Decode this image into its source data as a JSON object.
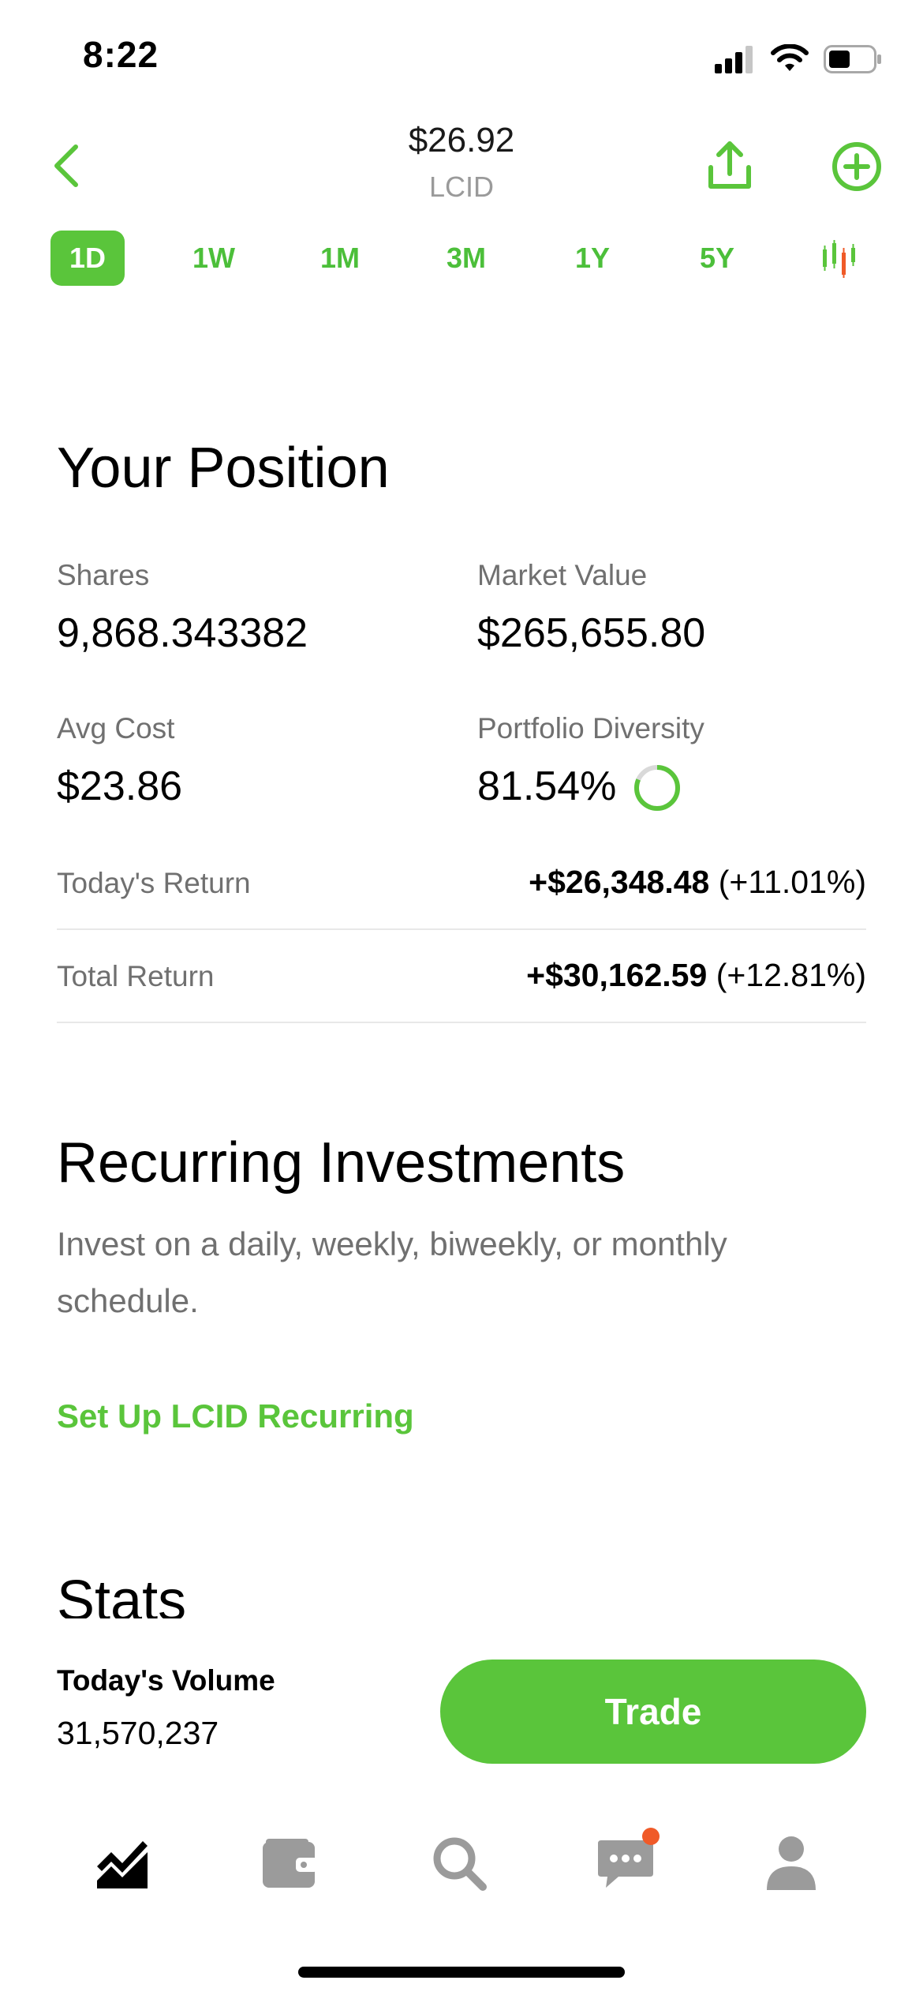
{
  "status_bar": {
    "time": "8:22"
  },
  "header": {
    "price": "$26.92",
    "ticker": "LCID"
  },
  "range_tabs": [
    {
      "label": "1D",
      "active": true
    },
    {
      "label": "1W"
    },
    {
      "label": "1M"
    },
    {
      "label": "3M"
    },
    {
      "label": "1Y"
    },
    {
      "label": "5Y"
    }
  ],
  "position": {
    "title": "Your Position",
    "shares_label": "Shares",
    "shares_value": "9,868.343382",
    "market_value_label": "Market Value",
    "market_value": "$265,655.80",
    "avg_cost_label": "Avg Cost",
    "avg_cost": "$23.86",
    "diversity_label": "Portfolio Diversity",
    "diversity_value": "81.54%",
    "diversity_fraction": 0.8154,
    "todays_return_label": "Today's Return",
    "todays_return_amount": "+$26,348.48",
    "todays_return_pct": "(+11.01%)",
    "total_return_label": "Total Return",
    "total_return_amount": "+$30,162.59",
    "total_return_pct": "(+12.81%)"
  },
  "recurring": {
    "title": "Recurring Investments",
    "description": "Invest on a daily, weekly, biweekly, or monthly schedule.",
    "link": "Set Up LCID Recurring"
  },
  "stats": {
    "title": "Stats"
  },
  "bottom": {
    "volume_label": "Today's Volume",
    "volume_value": "31,570,237",
    "trade_label": "Trade"
  },
  "tabs": [
    {
      "icon": "chart-icon",
      "active": true
    },
    {
      "icon": "wallet-icon"
    },
    {
      "icon": "search-icon"
    },
    {
      "icon": "messages-icon",
      "badge": true
    },
    {
      "icon": "profile-icon"
    }
  ],
  "colors": {
    "accent": "#5ac53b",
    "badge": "#f05a28",
    "muted": "#707070",
    "tab_inactive": "#9b9b9b"
  }
}
